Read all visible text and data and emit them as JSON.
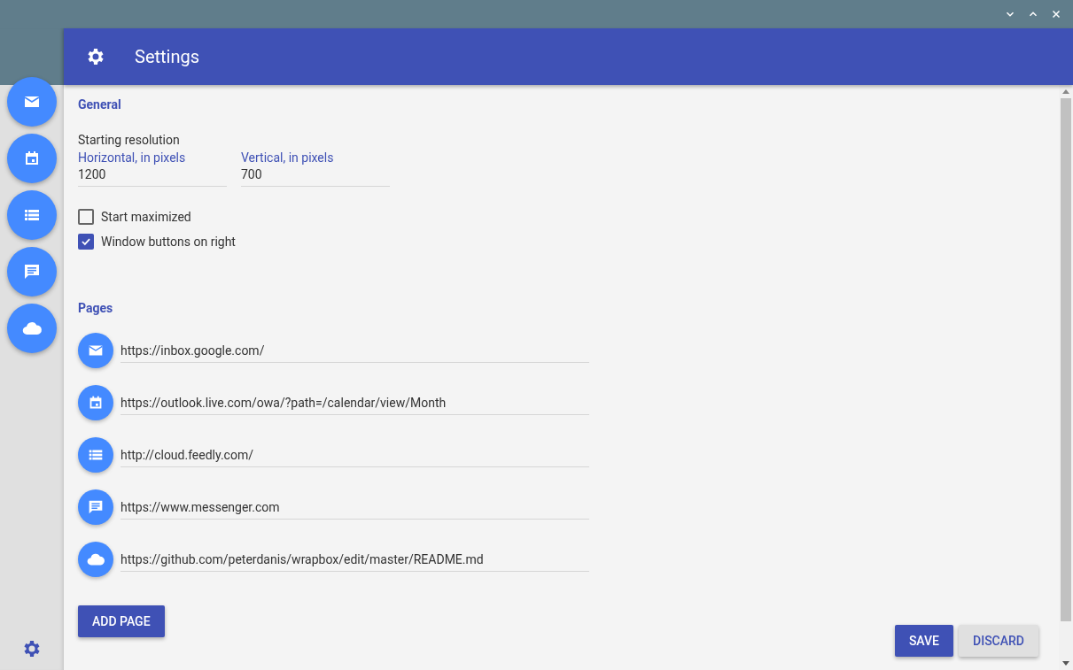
{
  "window": {
    "controls": [
      {
        "kind": "minimize"
      },
      {
        "kind": "maximize"
      },
      {
        "kind": "close"
      }
    ]
  },
  "sidebar": {
    "items": [
      {
        "kind": "mail"
      },
      {
        "kind": "calendar"
      },
      {
        "kind": "list"
      },
      {
        "kind": "chat"
      },
      {
        "kind": "cloud"
      }
    ]
  },
  "header": {
    "title": "Settings"
  },
  "general": {
    "heading": "General",
    "resolution_label": "Starting resolution",
    "fields": [
      {
        "label": "Horizontal, in pixels",
        "value": "1200"
      },
      {
        "label": "Vertical, in pixels",
        "value": "700"
      }
    ],
    "checkboxes": [
      {
        "label": "Start maximized",
        "checked": false
      },
      {
        "label": "Window buttons on right",
        "checked": true
      }
    ]
  },
  "pages": {
    "heading": "Pages",
    "items": [
      {
        "kind": "mail",
        "url": "https://inbox.google.com/"
      },
      {
        "kind": "calendar",
        "url": "https://outlook.live.com/owa/?path=/calendar/view/Month"
      },
      {
        "kind": "list",
        "url": "http://cloud.feedly.com/"
      },
      {
        "kind": "chat",
        "url": "https://www.messenger.com"
      },
      {
        "kind": "cloud",
        "url": "https://github.com/peterdanis/wrapbox/edit/master/README.md"
      }
    ],
    "add_button": "ADD PAGE"
  },
  "actions": {
    "save": "SAVE",
    "discard": "DISCARD"
  }
}
